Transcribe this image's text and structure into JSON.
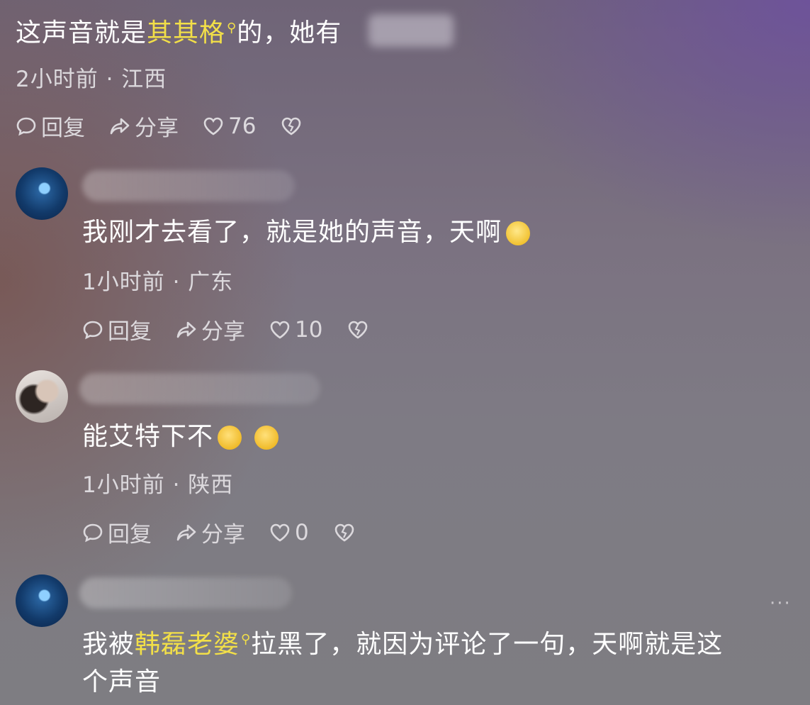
{
  "comments": [
    {
      "text_before": "这声音就是",
      "mention": "其其格",
      "text_after": "的，她有",
      "meta": "2小时前 · 江西",
      "actions": {
        "reply": "回复",
        "share": "分享",
        "likes": "76"
      }
    },
    {
      "text": "我刚才去看了，就是她的声音，天啊",
      "emoji": "flushed-face-emoji",
      "meta": "1小时前 · 广东",
      "actions": {
        "reply": "回复",
        "share": "分享",
        "likes": "10"
      }
    },
    {
      "text": "能艾特下不",
      "emoji": "crying-face-emoji",
      "meta": "1小时前 · 陕西",
      "actions": {
        "reply": "回复",
        "share": "分享",
        "likes": "0"
      }
    },
    {
      "text_before": "我被",
      "mention": "韩磊老婆",
      "text_after": "拉黑了，就因为评论了一句，天啊就是这",
      "text_line2": "个声音",
      "more": "···"
    }
  ]
}
